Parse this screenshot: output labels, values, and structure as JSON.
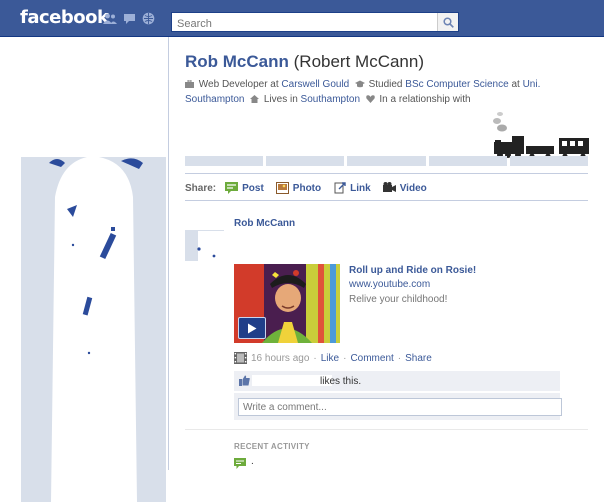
{
  "topbar": {
    "logo": "facebook",
    "jewels": [
      "friend-requests-icon",
      "messages-icon",
      "notifications-icon"
    ],
    "search": {
      "placeholder": "Search",
      "value": ""
    }
  },
  "profile": {
    "name": "Rob McCann",
    "alt_name": "(Robert McCann)",
    "info": {
      "work_prefix": "Web Developer at",
      "work_place": "Carswell Gould",
      "study_prefix": "Studied",
      "study_course": "BSc Computer Science",
      "study_at": "at",
      "study_school": "Uni. Southampton",
      "lives_prefix": "Lives in",
      "lives_place": "Southampton",
      "relationship": "In a relationship with"
    }
  },
  "share": {
    "label": "Share:",
    "options": [
      {
        "label": "Post",
        "icon": "status-icon"
      },
      {
        "label": "Photo",
        "icon": "photo-icon"
      },
      {
        "label": "Link",
        "icon": "link-icon"
      },
      {
        "label": "Video",
        "icon": "video-icon"
      }
    ]
  },
  "story": {
    "author": "Rob McCann",
    "link_title": "Roll up and Ride on Rosie!",
    "link_domain": "www.youtube.com",
    "link_desc": "Relive your childhood!",
    "time": "16 hours ago",
    "actions": [
      "Like",
      "Comment",
      "Share"
    ],
    "likes_text": "likes this.",
    "comment_placeholder": "Write a comment..."
  },
  "recent": {
    "heading": "RECENT ACTIVITY",
    "item": "."
  },
  "colors": {
    "brand": "#3b5998",
    "panel": "#edeff4",
    "pale": "#d8dfea"
  }
}
